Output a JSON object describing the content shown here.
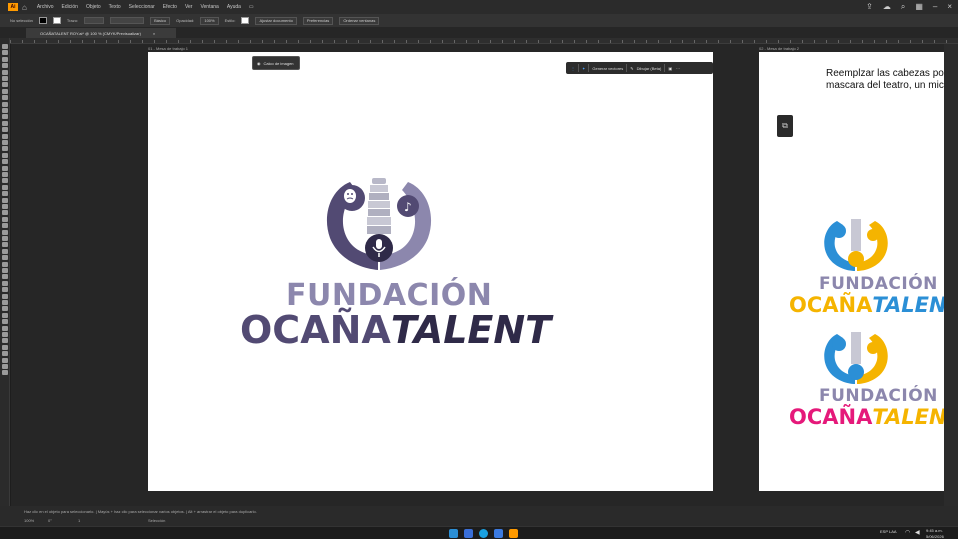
{
  "app": {
    "logo": "Ai",
    "menu": [
      "Archivo",
      "Edición",
      "Objeto",
      "Texto",
      "Seleccionar",
      "Efecto",
      "Ver",
      "Ventana",
      "Ayuda"
    ]
  },
  "control_bar": {
    "selection_label": "No selección",
    "stroke_label": "Trazo:",
    "basic_label": "Básico",
    "opacity_label": "Opacidad:",
    "opacity_value": "100%",
    "style_label": "Estilo:",
    "doc_setup": "Ajustar documento",
    "preferences": "Preferencias",
    "arrange": "Ordenar ventanas"
  },
  "document_tab": {
    "title": "OCAÑATALENT ROY.ai* @ 100 % (CMYK/Previsualizar)",
    "close": "×"
  },
  "artboards": [
    {
      "label": "01 - Mesa de trabajo 1"
    },
    {
      "label": "02 - Mesa de trabajo 2"
    }
  ],
  "trace_chip": {
    "label": "Calco de imagen"
  },
  "context_bar": {
    "generate": "Generar vectores",
    "draw": "Dibujar (Beta)",
    "more": "···"
  },
  "logo_main": {
    "line1": "FUNDACIÓN",
    "line2_a": "OCAÑA",
    "line2_b": "TALENT",
    "color_light": "#8c87ad",
    "color_dark": "#524a73"
  },
  "logo_side_1": {
    "line1": "FUNDACIÓN",
    "line2_a": "OCAÑA",
    "line2_b": "TALENT",
    "color_line1": "#8c87ad",
    "color_line2": "#f5b400",
    "color_talent": "#2b8fd6"
  },
  "logo_side_2": {
    "line1": "FUNDACIÓN",
    "line2_a": "OCAÑA",
    "line2_b": "TALEN",
    "color_line1": "#8c87ad",
    "color_line2": "#e5197a",
    "color_talent": "#f5b400"
  },
  "panel_note": {
    "line1": "Reemplzar las cabezas por",
    "line2": "mascara del teatro, un mic"
  },
  "status": {
    "hint": "Haz clic en el objeto para seleccionarlo. | Mayús + haz clic para seleccionar varios objetos. | Alt + arrastrar el objeto para duplicarlo.",
    "zoom": "100%",
    "rotation": "0°",
    "artboard_nav": "1",
    "tool": "Selección"
  },
  "taskbar": {
    "lang": "ESP LAA",
    "time": "9:45 a.m.",
    "date": "5/06/2026"
  }
}
